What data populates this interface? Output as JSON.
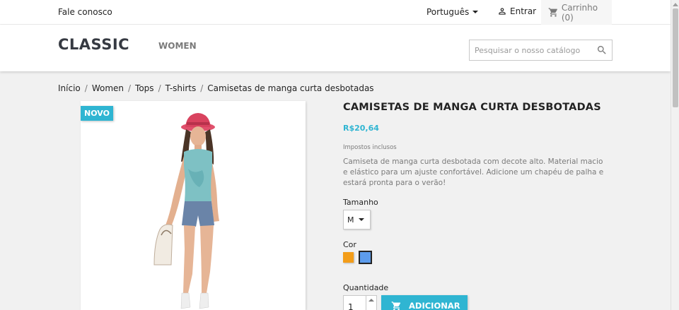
{
  "topbar": {
    "contact": "Fale conosco",
    "language": "Português",
    "signin": "Entrar",
    "cart": "Carrinho (0)"
  },
  "header": {
    "logo": "CLASSIC",
    "menu_women": "WOMEN",
    "search_placeholder": "Pesquisar o nosso catálogo"
  },
  "breadcrumb": [
    "Início",
    "Women",
    "Tops",
    "T-shirts",
    "Camisetas de manga curta desbotadas"
  ],
  "product": {
    "badge": "NOVO",
    "title": "CAMISETAS DE MANGA CURTA DESBOTADAS",
    "price": "R$20,64",
    "tax_note": "Impostos inclusos",
    "description": "Camiseta de manga curta desbotada com decote alto. Material macio e elástico para um ajuste confortável. Adicione um chapéu de palha e estará pronta para o verão!",
    "size_label": "Tamanho",
    "size_value": "M",
    "color_label": "Cor",
    "colors": [
      "#f39d19",
      "#5d9cec"
    ],
    "quantity_label": "Quantidade",
    "quantity": "1",
    "add_to_cart": "ADICIONAR"
  }
}
